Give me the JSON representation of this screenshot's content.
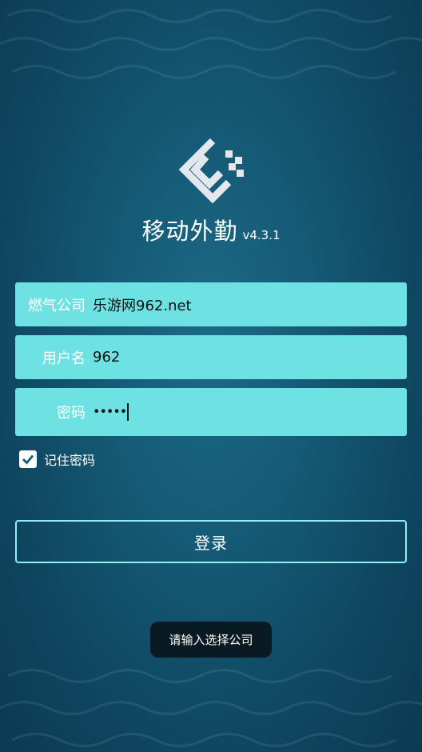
{
  "app": {
    "title": "移动外勤",
    "version": "v4.3.1"
  },
  "form": {
    "company": {
      "label": "燃气公司",
      "value": "乐游网962.net"
    },
    "username": {
      "label": "用户名",
      "value": "962"
    },
    "password": {
      "label": "密码",
      "masked_value": "•••••"
    },
    "remember": {
      "label": "记住密码",
      "checked": true
    }
  },
  "login_button": {
    "label": "登录"
  },
  "toast": {
    "message": "请输入选择公司"
  },
  "colors": {
    "field_bg": "#6ee2e3",
    "button_border": "#8ff0f2",
    "background": "#155a76",
    "toast_bg": "#0a1a22"
  },
  "icons": {
    "logo": "app-logo-icon",
    "checkbox": "checkmark-icon"
  }
}
